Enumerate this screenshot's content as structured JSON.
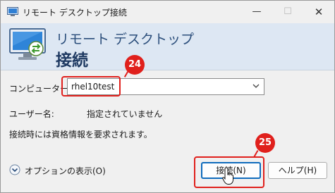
{
  "window": {
    "title": "リモート デスクトップ接続",
    "controls": {
      "minimize": "—",
      "maximize": "☐",
      "close": "✕"
    }
  },
  "banner": {
    "line1": "リモート デスクトップ",
    "line2": "接続",
    "icon": "monitor-connection-icon"
  },
  "form": {
    "computer_label": "コンピューター(C):",
    "computer_value": "rhel10test",
    "user_label": "ユーザー名:",
    "user_value": "指定されていません",
    "info": "接続時には資格情報を要求されます。"
  },
  "footer": {
    "options_label": "オプションの表示(O)",
    "connect_label": "接続(N)",
    "help_label": "ヘルプ(H)"
  },
  "annotations": {
    "badge_a": "24",
    "badge_b": "25",
    "color": "#e0201c"
  }
}
